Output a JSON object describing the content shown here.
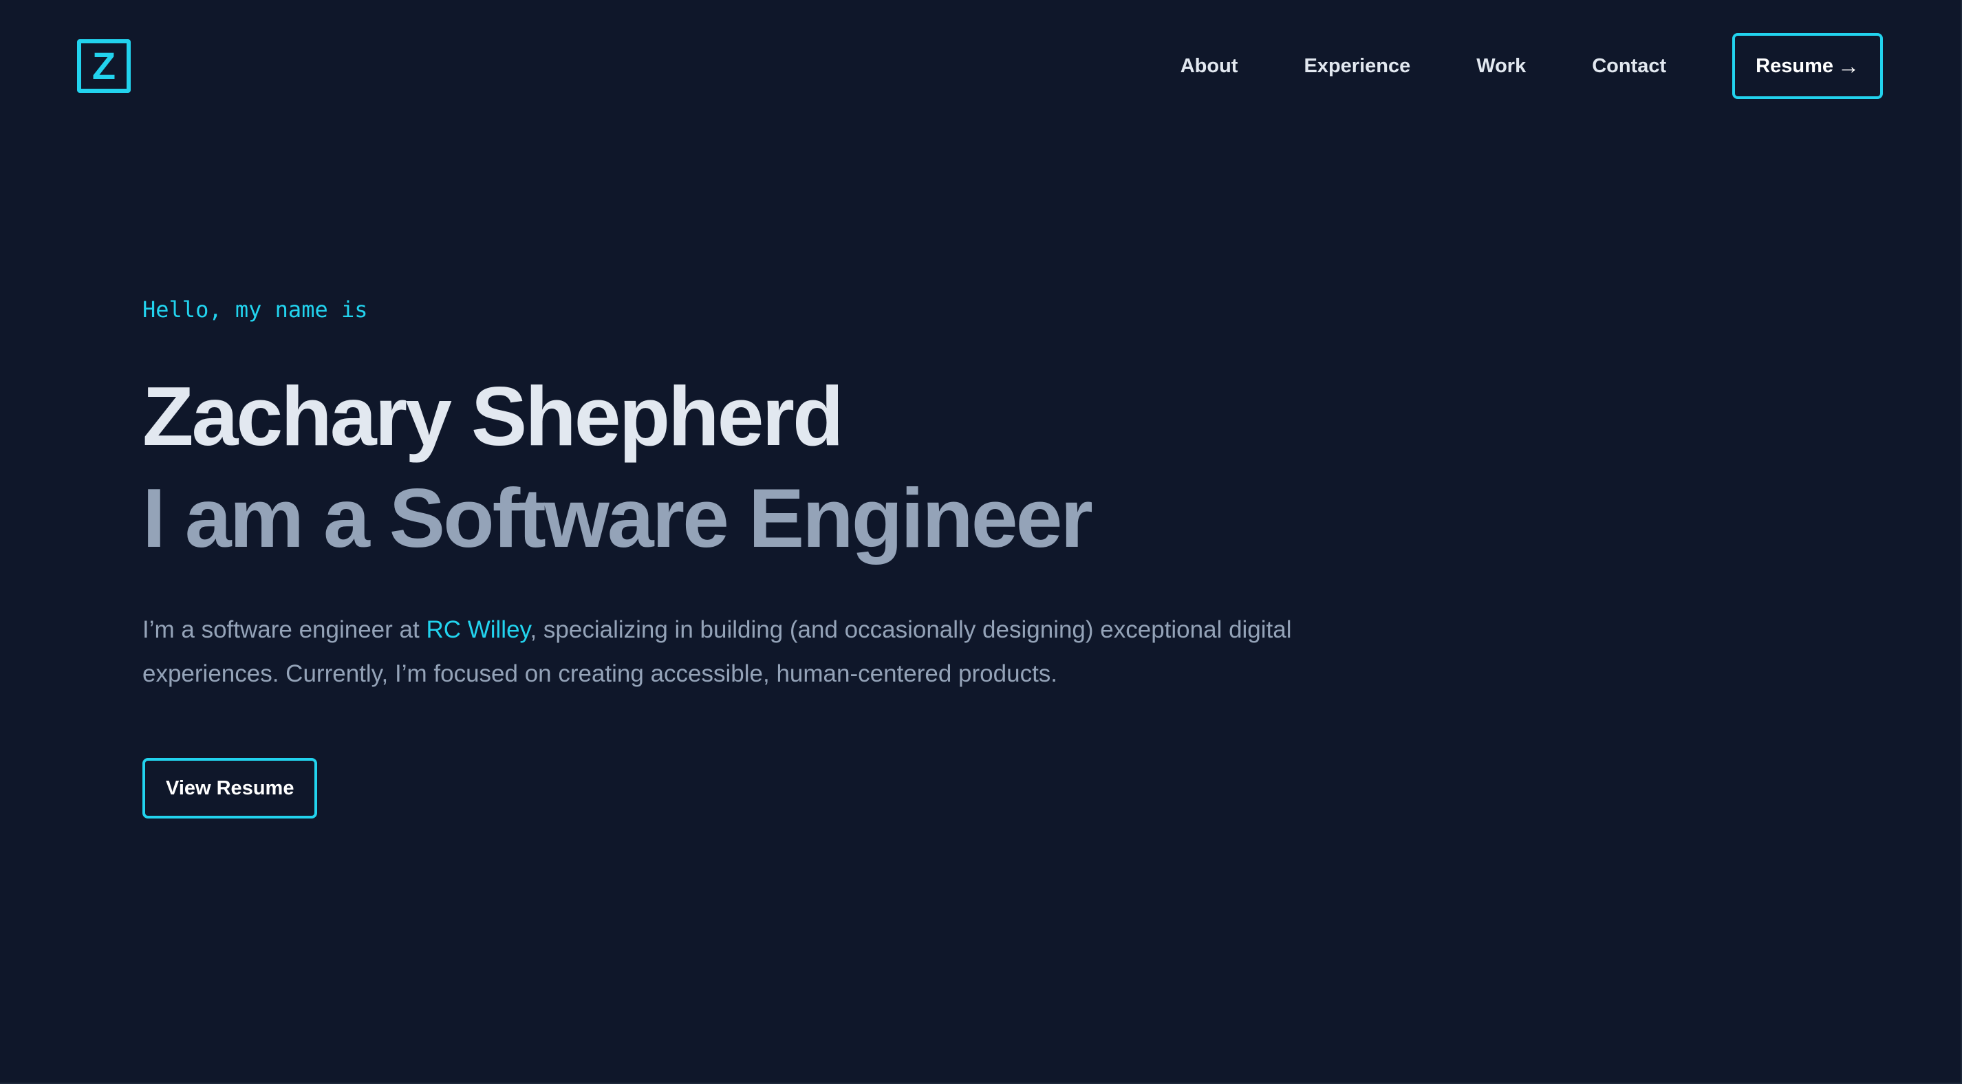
{
  "colors": {
    "background": "#0f172a",
    "accent": "#22d3ee",
    "heading": "#e2e8f0",
    "muted": "#94a3b8"
  },
  "header": {
    "logo_letter": "Z",
    "nav": {
      "items": [
        {
          "label": "About"
        },
        {
          "label": "Experience"
        },
        {
          "label": "Work"
        },
        {
          "label": "Contact"
        }
      ],
      "resume_label": "Resume",
      "resume_icon": "arrow-right-icon",
      "resume_arrow": "→"
    }
  },
  "hero": {
    "greeting": "Hello, my name is",
    "name": "Zachary Shepherd",
    "role": "I am a Software Engineer",
    "bio": {
      "before_link": "I’m a software engineer at ",
      "link_text": "RC Willey",
      "after_link": ", specializing in building (and occasionally designing) exceptional digital experiences. Currently, I’m focused on creating accessible, human-centered products."
    },
    "cta_label": "View Resume"
  }
}
